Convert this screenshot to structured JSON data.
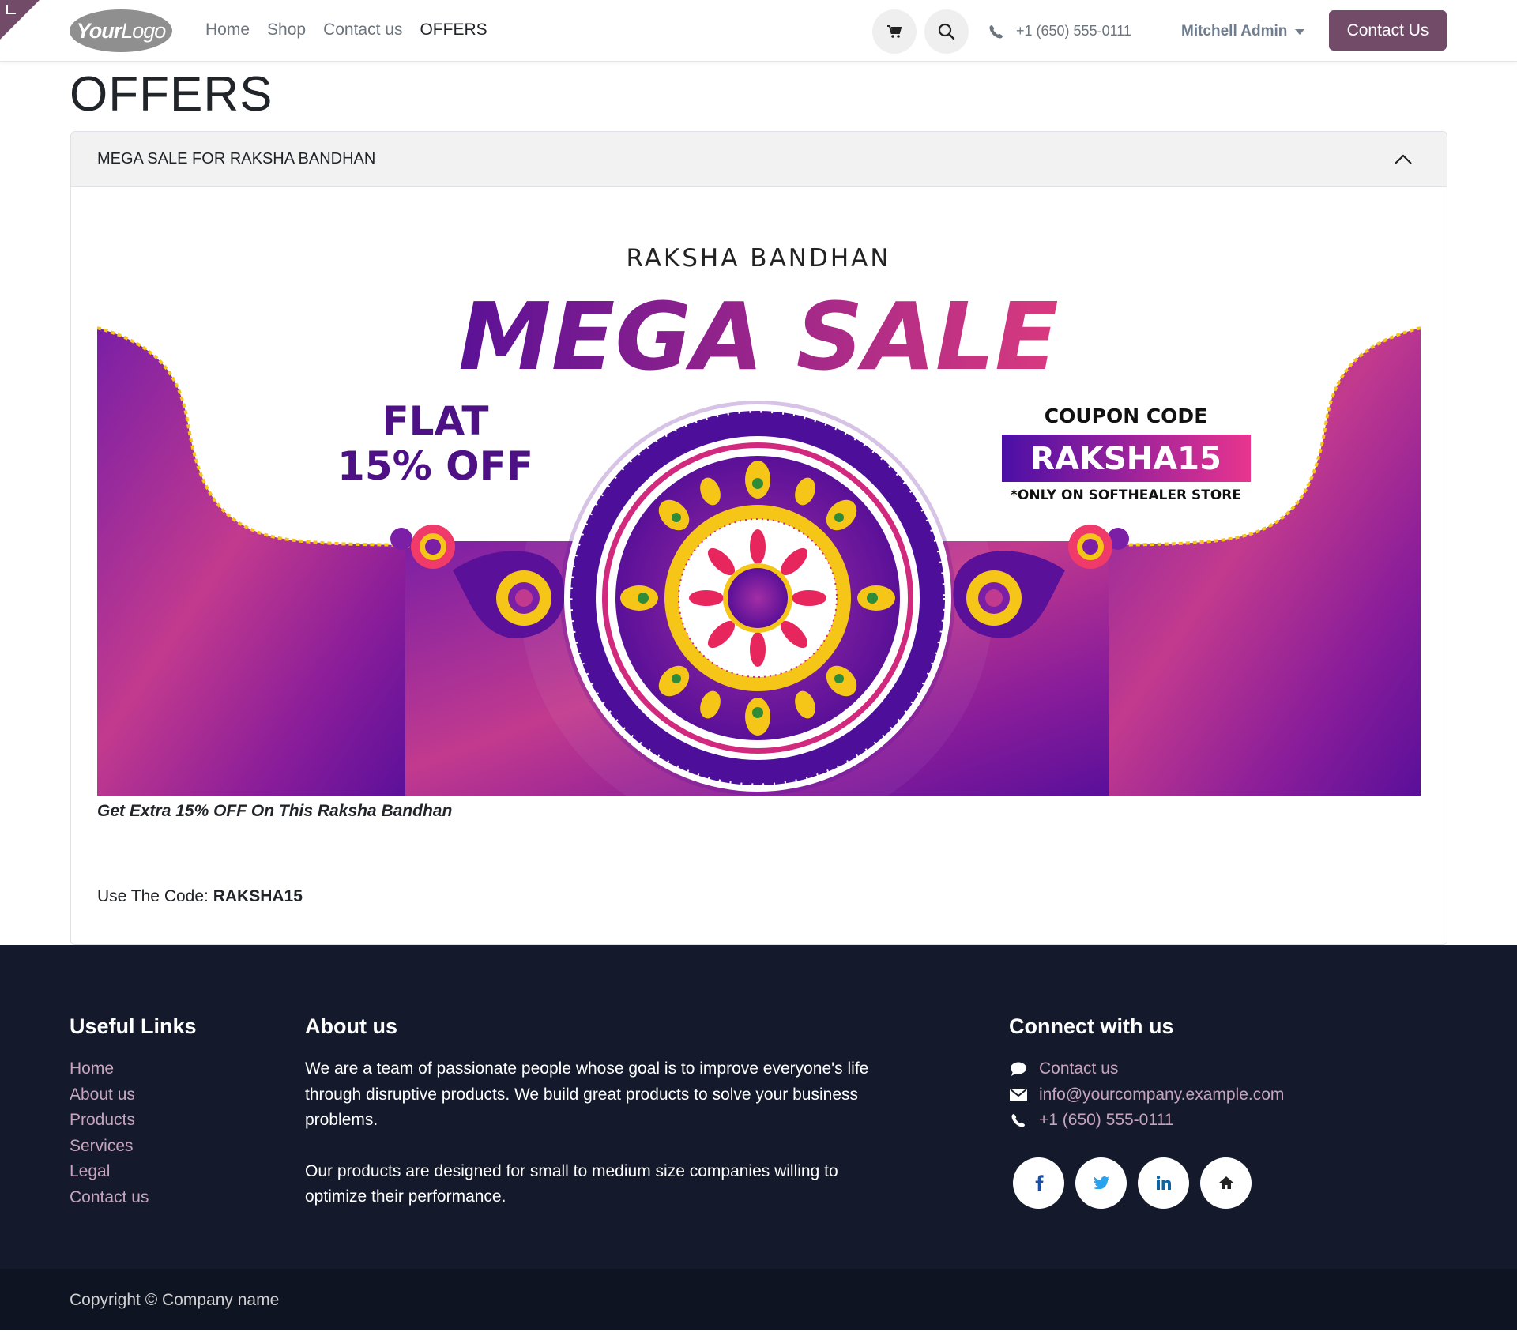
{
  "header": {
    "logo": {
      "part1": "Your",
      "part2": "Logo"
    },
    "nav": [
      {
        "label": "Home",
        "active": false
      },
      {
        "label": "Shop",
        "active": false
      },
      {
        "label": "Contact us",
        "active": false
      },
      {
        "label": "OFFERS",
        "active": true
      }
    ],
    "phone": "+1 (650) 555-0111",
    "user": "Mitchell Admin",
    "cta_label": "Contact Us",
    "icons": {
      "cart": "cart-icon",
      "search": "search-icon",
      "phone": "phone-icon"
    }
  },
  "main": {
    "title": "OFFERS",
    "accordion": {
      "title": "MEGA SALE FOR RAKSHA BANDHAN",
      "expanded": true,
      "banner": {
        "top_text": "RAKSHA BANDHAN",
        "headline": "MEGA SALE",
        "flat": "FLAT",
        "discount": "15% OFF",
        "coupon_label": "COUPON CODE",
        "coupon_code": "RAKSHA15",
        "store_note": "*ONLY ON SOFTHEALER STORE"
      },
      "promo_text": "Get Extra 15% OFF On This Raksha Bandhan",
      "code_prefix": "Use The Code:",
      "code": "RAKSHA15"
    }
  },
  "footer": {
    "useful_links": {
      "heading": "Useful Links",
      "links": [
        "Home",
        "About us",
        "Products",
        "Services",
        "Legal",
        "Contact us"
      ]
    },
    "about": {
      "heading": "About us",
      "paragraphs": [
        "We are a team of passionate people whose goal is to improve everyone's life through disruptive products. We build great products to solve your business problems.",
        "Our products are designed for small to medium size companies willing to optimize their performance."
      ]
    },
    "connect": {
      "heading": "Connect with us",
      "contact_label": "Contact us",
      "email": "info@yourcompany.example.com",
      "phone": "+1 (650) 555-0111",
      "socials": [
        "facebook-icon",
        "twitter-icon",
        "linkedin-icon",
        "home-icon"
      ]
    },
    "copyright": "Copyright © Company name"
  },
  "colors": {
    "brand": "#714B67",
    "footer_bg": "#141a2b",
    "link": "#c6a4bd"
  }
}
